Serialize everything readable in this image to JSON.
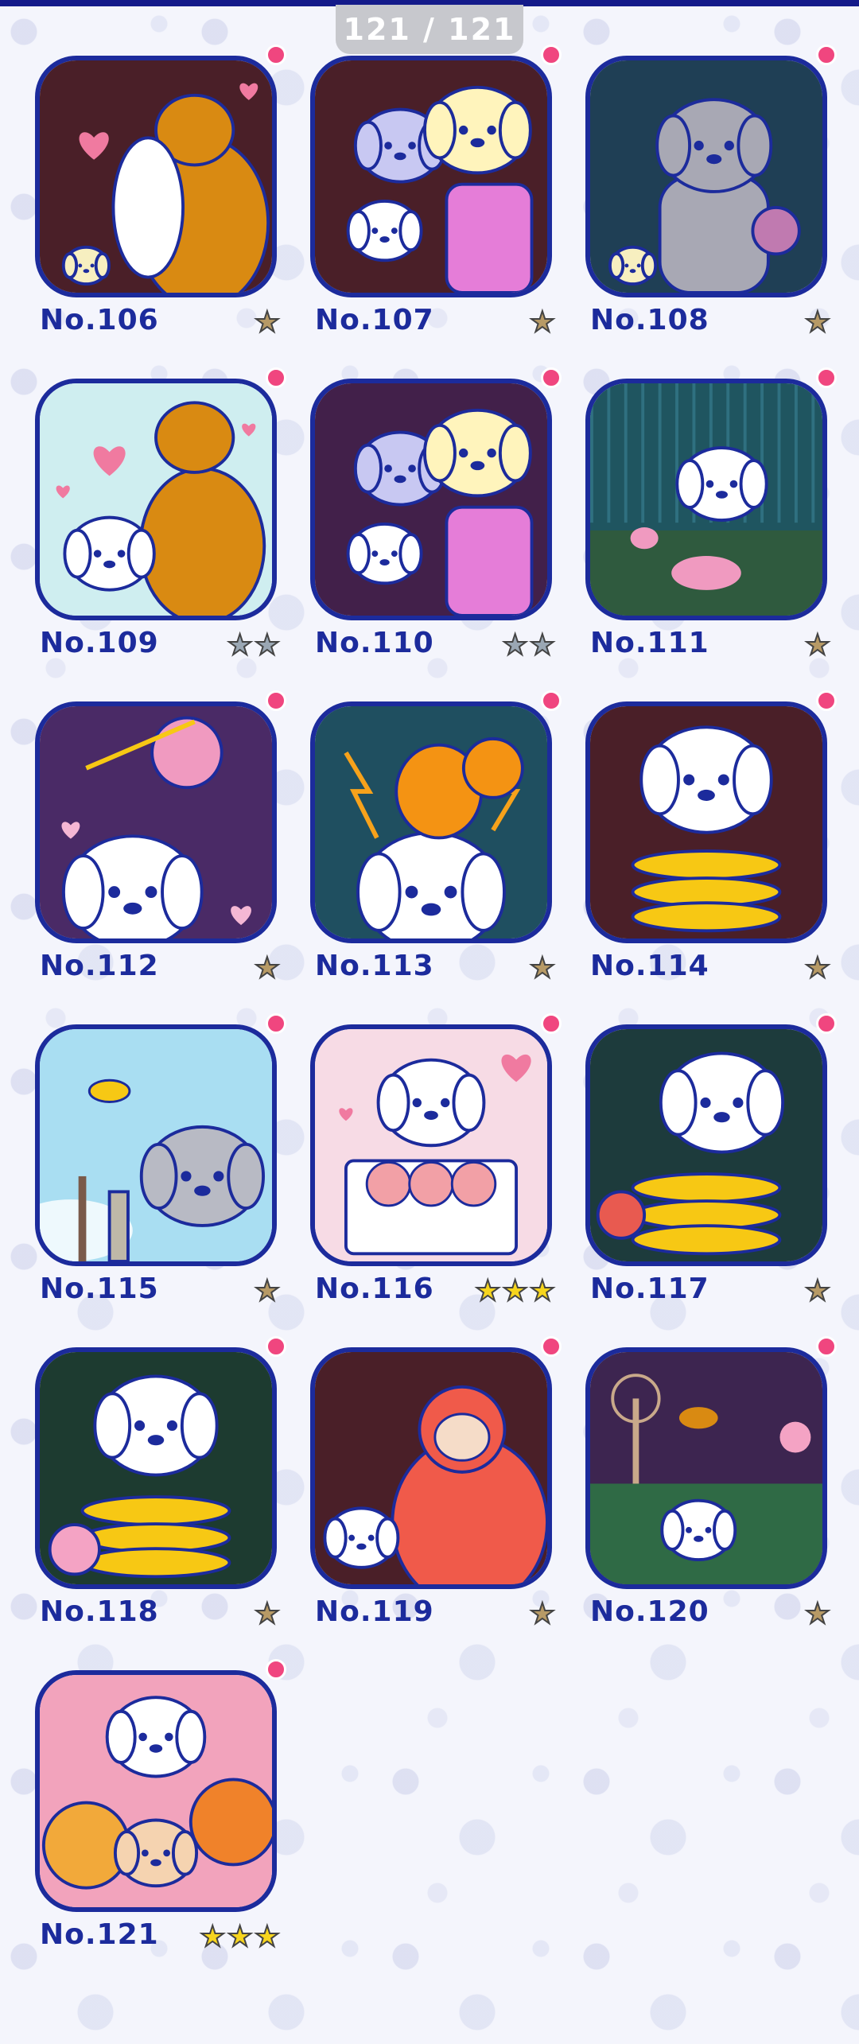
{
  "counter": "121 / 121",
  "colors": {
    "frame": "#1c2b9c",
    "label": "#1c2b9c",
    "new_dot": "#f0467f",
    "star_gold": "#f7d51d",
    "star_bronze": "#b79a66",
    "star_silver": "#9aa7b4"
  },
  "cards": [
    {
      "label": "No.106",
      "stars": 1,
      "star_color": "bronze",
      "new": true,
      "bg": "#4a1f28",
      "subject": "bear-hugging-dog"
    },
    {
      "label": "No.107",
      "stars": 1,
      "star_color": "bronze",
      "new": true,
      "bg": "#4a1f28",
      "subject": "poodle-and-dogs"
    },
    {
      "label": "No.108",
      "stars": 1,
      "star_color": "bronze",
      "new": true,
      "bg": "#1f3f55",
      "subject": "koala-with-cupcake"
    },
    {
      "label": "No.109",
      "stars": 2,
      "star_color": "silver",
      "new": true,
      "bg": "#cfeef0",
      "subject": "bear-and-dog-hearts"
    },
    {
      "label": "No.110",
      "stars": 2,
      "star_color": "silver",
      "new": true,
      "bg": "#42204a",
      "subject": "poodle-hug"
    },
    {
      "label": "No.111",
      "stars": 1,
      "star_color": "bronze",
      "new": true,
      "bg": "#1f5560",
      "subject": "dog-in-rain"
    },
    {
      "label": "No.112",
      "stars": 1,
      "star_color": "bronze",
      "new": true,
      "bg": "#4a2a66",
      "subject": "imp-and-dog"
    },
    {
      "label": "No.113",
      "stars": 1,
      "star_color": "bronze",
      "new": true,
      "bg": "#1f4f60",
      "subject": "squirrel-on-dog"
    },
    {
      "label": "No.114",
      "stars": 1,
      "star_color": "bronze",
      "new": true,
      "bg": "#4a1f28",
      "subject": "snake-wrapping-dog"
    },
    {
      "label": "No.115",
      "stars": 1,
      "star_color": "bronze",
      "new": true,
      "bg": "#a9def2",
      "subject": "grey-dog-and-bird"
    },
    {
      "label": "No.116",
      "stars": 3,
      "star_color": "gold",
      "new": true,
      "bg": "#f7dbe5",
      "subject": "dog-with-peaches"
    },
    {
      "label": "No.117",
      "stars": 1,
      "star_color": "bronze",
      "new": true,
      "bg": "#1d3b3c",
      "subject": "snake-dog-monkey"
    },
    {
      "label": "No.118",
      "stars": 1,
      "star_color": "bronze",
      "new": true,
      "bg": "#1d3b30",
      "subject": "snake-dog-elephant"
    },
    {
      "label": "No.119",
      "stars": 1,
      "star_color": "bronze",
      "new": true,
      "bg": "#4a1f28",
      "subject": "red-gorilla"
    },
    {
      "label": "No.120",
      "stars": 1,
      "star_color": "bronze",
      "new": true,
      "bg": "#3d2550",
      "subject": "kangaroo-field"
    },
    {
      "label": "No.121",
      "stars": 3,
      "star_color": "gold",
      "new": true,
      "bg": "#f2a3bc",
      "subject": "animal-group"
    }
  ]
}
